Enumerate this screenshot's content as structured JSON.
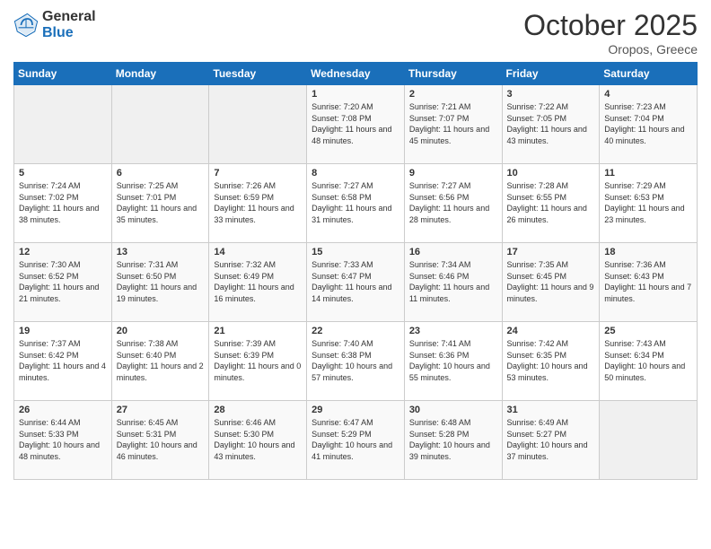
{
  "header": {
    "logo_general": "General",
    "logo_blue": "Blue",
    "month_title": "October 2025",
    "location": "Oropos, Greece"
  },
  "days_of_week": [
    "Sunday",
    "Monday",
    "Tuesday",
    "Wednesday",
    "Thursday",
    "Friday",
    "Saturday"
  ],
  "weeks": [
    [
      {
        "day": "",
        "sunrise": "",
        "sunset": "",
        "daylight": "",
        "empty": true
      },
      {
        "day": "",
        "sunrise": "",
        "sunset": "",
        "daylight": "",
        "empty": true
      },
      {
        "day": "",
        "sunrise": "",
        "sunset": "",
        "daylight": "",
        "empty": true
      },
      {
        "day": "1",
        "sunrise": "7:20 AM",
        "sunset": "7:08 PM",
        "daylight": "11 hours and 48 minutes."
      },
      {
        "day": "2",
        "sunrise": "7:21 AM",
        "sunset": "7:07 PM",
        "daylight": "11 hours and 45 minutes."
      },
      {
        "day": "3",
        "sunrise": "7:22 AM",
        "sunset": "7:05 PM",
        "daylight": "11 hours and 43 minutes."
      },
      {
        "day": "4",
        "sunrise": "7:23 AM",
        "sunset": "7:04 PM",
        "daylight": "11 hours and 40 minutes."
      }
    ],
    [
      {
        "day": "5",
        "sunrise": "7:24 AM",
        "sunset": "7:02 PM",
        "daylight": "11 hours and 38 minutes."
      },
      {
        "day": "6",
        "sunrise": "7:25 AM",
        "sunset": "7:01 PM",
        "daylight": "11 hours and 35 minutes."
      },
      {
        "day": "7",
        "sunrise": "7:26 AM",
        "sunset": "6:59 PM",
        "daylight": "11 hours and 33 minutes."
      },
      {
        "day": "8",
        "sunrise": "7:27 AM",
        "sunset": "6:58 PM",
        "daylight": "11 hours and 31 minutes."
      },
      {
        "day": "9",
        "sunrise": "7:27 AM",
        "sunset": "6:56 PM",
        "daylight": "11 hours and 28 minutes."
      },
      {
        "day": "10",
        "sunrise": "7:28 AM",
        "sunset": "6:55 PM",
        "daylight": "11 hours and 26 minutes."
      },
      {
        "day": "11",
        "sunrise": "7:29 AM",
        "sunset": "6:53 PM",
        "daylight": "11 hours and 23 minutes."
      }
    ],
    [
      {
        "day": "12",
        "sunrise": "7:30 AM",
        "sunset": "6:52 PM",
        "daylight": "11 hours and 21 minutes."
      },
      {
        "day": "13",
        "sunrise": "7:31 AM",
        "sunset": "6:50 PM",
        "daylight": "11 hours and 19 minutes."
      },
      {
        "day": "14",
        "sunrise": "7:32 AM",
        "sunset": "6:49 PM",
        "daylight": "11 hours and 16 minutes."
      },
      {
        "day": "15",
        "sunrise": "7:33 AM",
        "sunset": "6:47 PM",
        "daylight": "11 hours and 14 minutes."
      },
      {
        "day": "16",
        "sunrise": "7:34 AM",
        "sunset": "6:46 PM",
        "daylight": "11 hours and 11 minutes."
      },
      {
        "day": "17",
        "sunrise": "7:35 AM",
        "sunset": "6:45 PM",
        "daylight": "11 hours and 9 minutes."
      },
      {
        "day": "18",
        "sunrise": "7:36 AM",
        "sunset": "6:43 PM",
        "daylight": "11 hours and 7 minutes."
      }
    ],
    [
      {
        "day": "19",
        "sunrise": "7:37 AM",
        "sunset": "6:42 PM",
        "daylight": "11 hours and 4 minutes."
      },
      {
        "day": "20",
        "sunrise": "7:38 AM",
        "sunset": "6:40 PM",
        "daylight": "11 hours and 2 minutes."
      },
      {
        "day": "21",
        "sunrise": "7:39 AM",
        "sunset": "6:39 PM",
        "daylight": "11 hours and 0 minutes."
      },
      {
        "day": "22",
        "sunrise": "7:40 AM",
        "sunset": "6:38 PM",
        "daylight": "10 hours and 57 minutes."
      },
      {
        "day": "23",
        "sunrise": "7:41 AM",
        "sunset": "6:36 PM",
        "daylight": "10 hours and 55 minutes."
      },
      {
        "day": "24",
        "sunrise": "7:42 AM",
        "sunset": "6:35 PM",
        "daylight": "10 hours and 53 minutes."
      },
      {
        "day": "25",
        "sunrise": "7:43 AM",
        "sunset": "6:34 PM",
        "daylight": "10 hours and 50 minutes."
      }
    ],
    [
      {
        "day": "26",
        "sunrise": "6:44 AM",
        "sunset": "5:33 PM",
        "daylight": "10 hours and 48 minutes."
      },
      {
        "day": "27",
        "sunrise": "6:45 AM",
        "sunset": "5:31 PM",
        "daylight": "10 hours and 46 minutes."
      },
      {
        "day": "28",
        "sunrise": "6:46 AM",
        "sunset": "5:30 PM",
        "daylight": "10 hours and 43 minutes."
      },
      {
        "day": "29",
        "sunrise": "6:47 AM",
        "sunset": "5:29 PM",
        "daylight": "10 hours and 41 minutes."
      },
      {
        "day": "30",
        "sunrise": "6:48 AM",
        "sunset": "5:28 PM",
        "daylight": "10 hours and 39 minutes."
      },
      {
        "day": "31",
        "sunrise": "6:49 AM",
        "sunset": "5:27 PM",
        "daylight": "10 hours and 37 minutes."
      },
      {
        "day": "",
        "sunrise": "",
        "sunset": "",
        "daylight": "",
        "empty": true
      }
    ]
  ]
}
